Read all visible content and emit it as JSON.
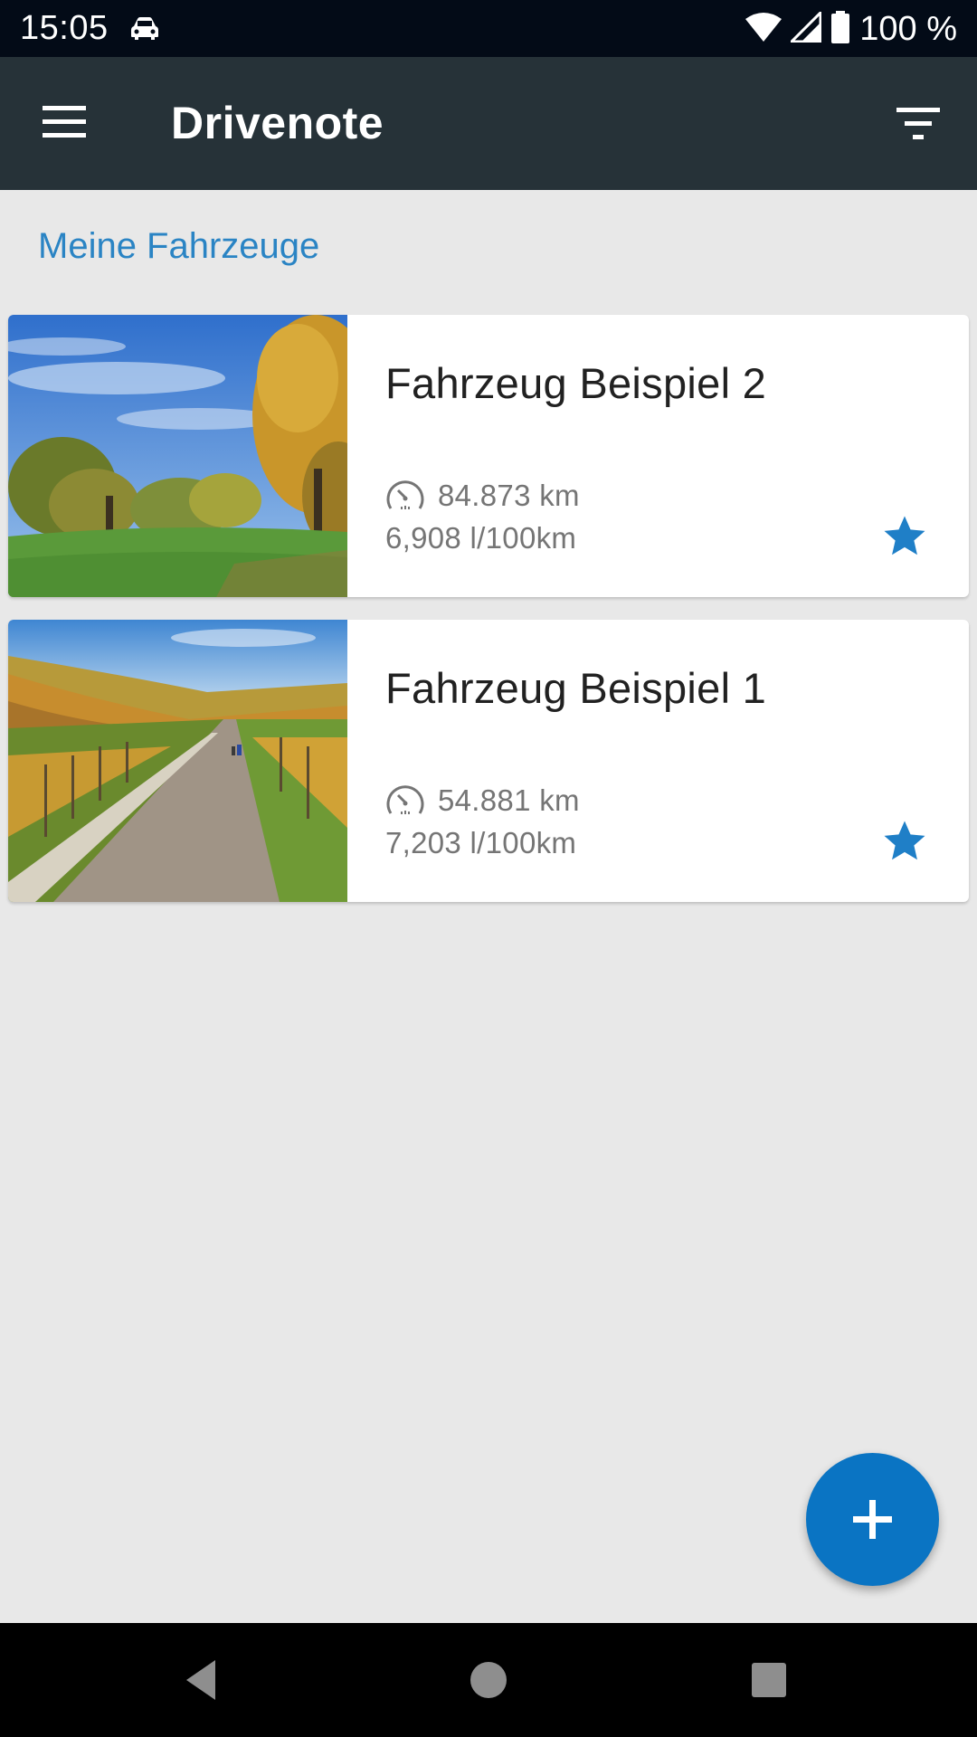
{
  "status_bar": {
    "time": "15:05",
    "battery_text": "100 %",
    "icons": [
      "car-icon",
      "wifi-icon",
      "signal-icon",
      "battery-icon"
    ]
  },
  "toolbar": {
    "title": "Drivenote",
    "icons": [
      "menu-icon",
      "filter-icon"
    ]
  },
  "section": {
    "title": "Meine Fahrzeuge",
    "color": "#2a84c4"
  },
  "vehicles": [
    {
      "name": "Fahrzeug Beispiel 2",
      "mileage": "84.873 km",
      "consumption": "6,908 l/100km",
      "favorite": true,
      "image": "autumn-meadow-trees"
    },
    {
      "name": "Fahrzeug Beispiel 1",
      "mileage": "54.881 km",
      "consumption": "7,203 l/100km",
      "favorite": true,
      "image": "vineyard-path"
    }
  ],
  "fab": {
    "icon": "plus-icon",
    "color": "#0a74c3"
  },
  "nav": {
    "icons": [
      "back-icon",
      "home-icon",
      "recents-icon"
    ]
  },
  "colors": {
    "toolbar": "#263238",
    "status_bar": "#030b17",
    "accent": "#1f7fc7",
    "background": "#e8e8e8"
  }
}
